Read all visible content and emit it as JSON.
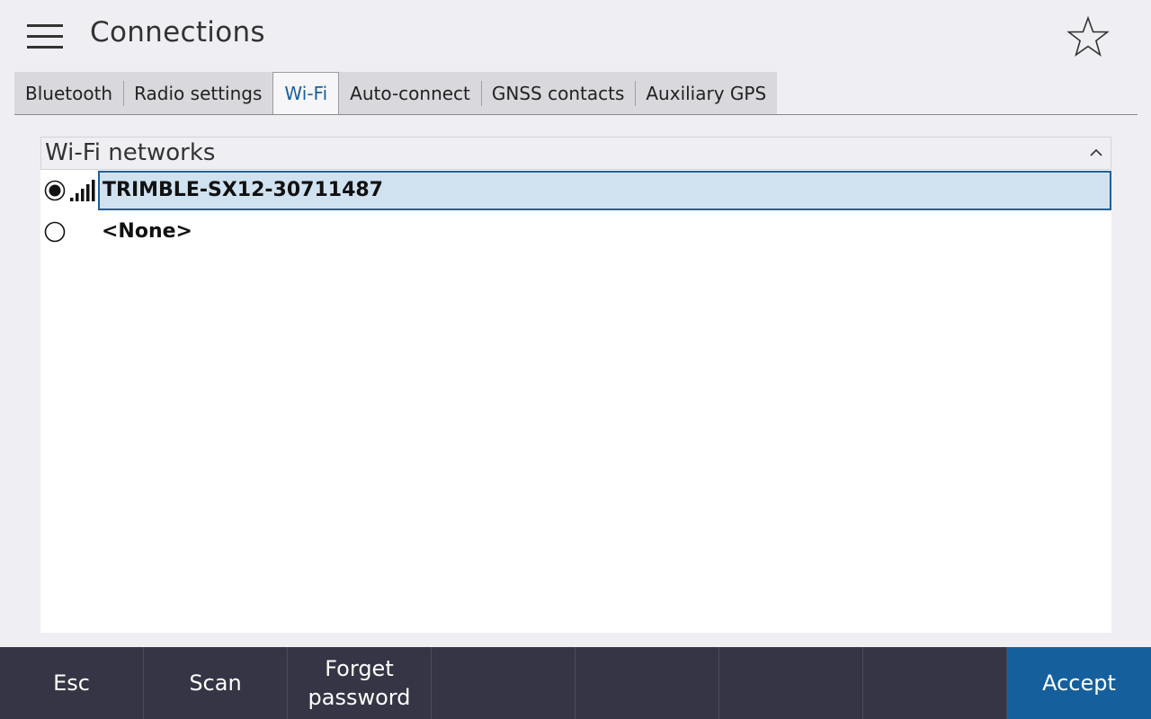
{
  "header": {
    "title": "Connections",
    "menu_icon": "hamburger-menu-icon",
    "favorite_icon": "star-outline-icon"
  },
  "tabs": [
    {
      "label": "Bluetooth",
      "active": false
    },
    {
      "label": "Radio settings",
      "active": false
    },
    {
      "label": "Wi-Fi",
      "active": true
    },
    {
      "label": "Auto-connect",
      "active": false
    },
    {
      "label": "GNSS contacts",
      "active": false
    },
    {
      "label": "Auxiliary GPS",
      "active": false
    }
  ],
  "group": {
    "title": "Wi-Fi networks",
    "collapse_icon": "chevron-up-icon",
    "networks": [
      {
        "name": "TRIMBLE-SX12-30711487",
        "selected": true,
        "signal_icon": "signal-strength-icon",
        "signal_bars": 4
      },
      {
        "name": "<None>",
        "selected": false
      }
    ]
  },
  "footer": {
    "buttons": [
      "Esc",
      "Scan",
      "Forget\npassword",
      "",
      "",
      "",
      "",
      "Accept"
    ]
  },
  "colors": {
    "background": "#efeff3",
    "footer": "#353545",
    "accent": "#15609c",
    "selection_fill": "#d0e2f0",
    "selection_border": "#1f5f96",
    "active_tab_text": "#1d5f9a"
  }
}
